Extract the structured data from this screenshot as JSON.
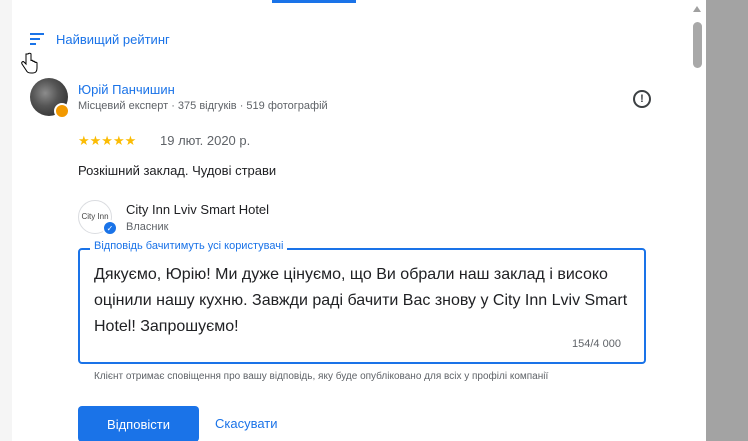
{
  "sort": {
    "label": "Найвищий рейтинг",
    "icon": "sort-icon"
  },
  "review": {
    "author_name": "Юрій Панчишин",
    "author_meta": "Місцевий експерт · 375 відгуків · 519 фотографій",
    "stars": "★★★★★",
    "rating": 5,
    "date": "19 лют. 2020 р.",
    "text": "Розкішний заклад. Чудові страви",
    "flag_icon": "report-flag-icon"
  },
  "owner": {
    "logo_text": "City Inn",
    "name": "City Inn Lviv Smart Hotel",
    "role": "Власник"
  },
  "reply": {
    "legend": "Відповідь бачитимуть усі користувачі",
    "text": "Дякуємо, Юрію! Ми дуже цінуємо, що Ви обрали наш заклад і високо оцінили нашу кухню. Завжди раді бачити Вас знову у City Inn Lviv Smart Hotel! Запрошуємо!",
    "char_count": "154/4 000",
    "notice": "Клієнт отримає сповіщення про вашу відповідь, яку буде опубліковано для всіх у профілі компанії",
    "submit_label": "Відповісти",
    "cancel_label": "Скасувати"
  },
  "colors": {
    "accent": "#1a73e8",
    "star": "#fbbc04",
    "local_guide_badge": "#f29900"
  }
}
